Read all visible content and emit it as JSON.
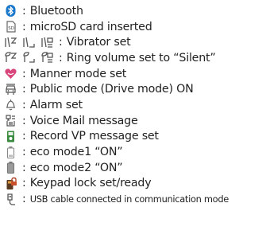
{
  "colors": {
    "text": "#222222",
    "bluetooth": "#1b78c9",
    "heart": "#d8457a",
    "battery": "#3a8a3f",
    "gray": "#777777"
  },
  "colon": ":",
  "items": [
    {
      "icons": [
        "bluetooth-icon"
      ],
      "label": "Bluetooth"
    },
    {
      "icons": [
        "microsd-icon"
      ],
      "label": "microSD card inserted"
    },
    {
      "icons": [
        "vibrator-icon-1",
        "vibrator-icon-2",
        "vibrator-icon-3"
      ],
      "label": "Vibrator set"
    },
    {
      "icons": [
        "ring-silent-icon-1",
        "ring-silent-icon-2",
        "ring-silent-icon-3"
      ],
      "label": "Ring volume set to “Silent”"
    },
    {
      "icons": [
        "manner-mode-icon"
      ],
      "label": "Manner mode set"
    },
    {
      "icons": [
        "public-mode-icon"
      ],
      "label": "Public mode (Drive mode) ON"
    },
    {
      "icons": [
        "alarm-icon"
      ],
      "label": "Alarm set"
    },
    {
      "icons": [
        "voice-mail-icon"
      ],
      "label": "Voice Mail message"
    },
    {
      "icons": [
        "record-vp-icon"
      ],
      "label": "Record VP message set"
    },
    {
      "icons": [
        "eco-mode1-icon"
      ],
      "label": "eco mode1 “ON”"
    },
    {
      "icons": [
        "eco-mode2-icon"
      ],
      "label": "eco mode2 “ON”"
    },
    {
      "icons": [
        "keypad-lock-icon"
      ],
      "label": "Keypad lock set/ready"
    },
    {
      "icons": [
        "usb-cable-icon"
      ],
      "label": "USB cable connected in communication mode"
    }
  ]
}
